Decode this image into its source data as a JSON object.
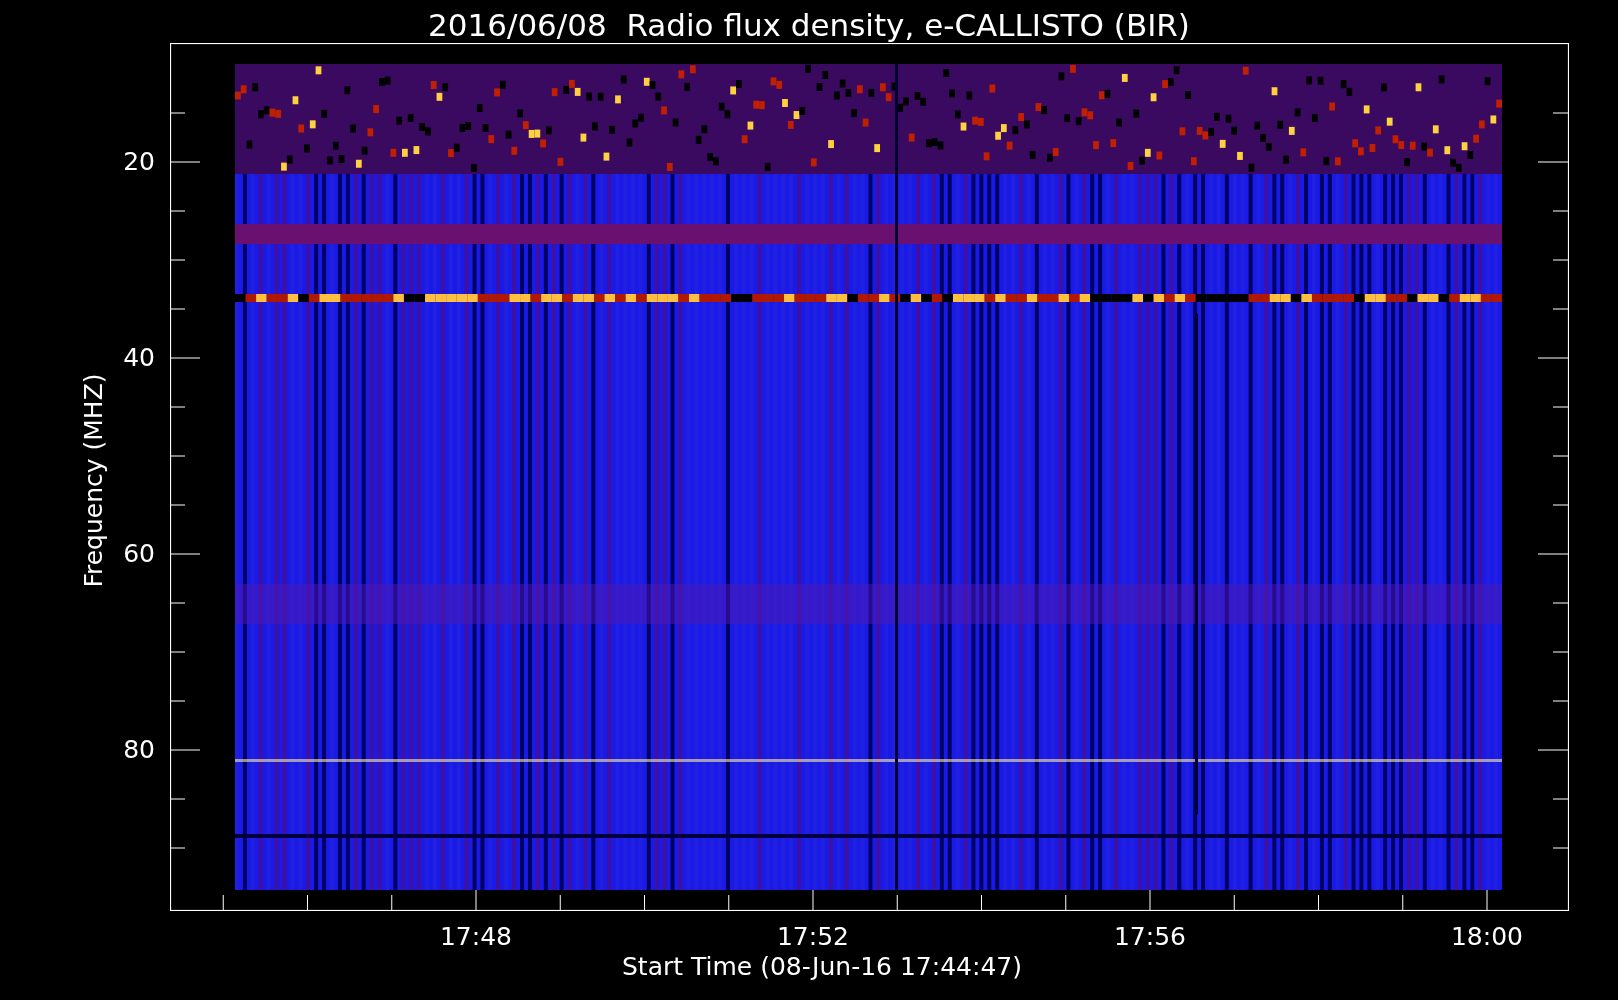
{
  "title": "2016/06/08  Radio flux density, e-CALLISTO (BIR)",
  "y_axis": {
    "label": "Frequency (MHZ)",
    "ticks": [
      "20",
      "40",
      "60",
      "80"
    ]
  },
  "x_axis": {
    "label": "Start Time (08-Jun-16 17:44:47)",
    "ticks": [
      "17:48",
      "17:52",
      "17:56",
      "18:00"
    ]
  }
}
